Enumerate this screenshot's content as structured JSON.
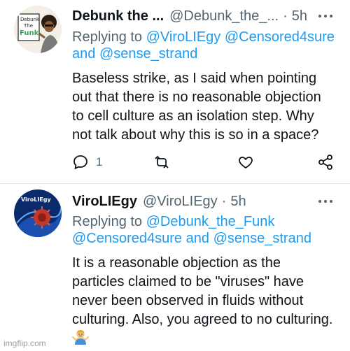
{
  "tweets": [
    {
      "display_name": "Debunk the ...",
      "handle": "@Debunk_the_...",
      "time": "5h",
      "reply_prefix": "Replying to",
      "reply_mention_1": "@ViroLIEgy",
      "reply_mention_2": "@Censored4sure",
      "reply_and": "and",
      "reply_mention_3": "@sense_strand",
      "body_lines": [
        "Baseless strike, as I said when pointing",
        "out that there is no reasonable objection",
        "to cell culture as an isolation step. Why",
        "not talk about why this is so in a space?"
      ],
      "reply_count": "1",
      "avatar_text": {
        "line1": "Debunk",
        "line2": "The",
        "line3": "Funk"
      }
    },
    {
      "display_name": "ViroLIEgy",
      "handle": "@ViroLIEgy",
      "time": "5h",
      "reply_prefix": "Replying to",
      "reply_mention_1": "@Debunk_the_Funk",
      "reply_mention_2": "@Censored4sure",
      "reply_and": "and",
      "reply_mention_3": "@sense_strand",
      "body_lines": [
        "It is a reasonable objection as the",
        "particles claimed to be \"viruses\" have",
        "never been observed in fluids without",
        "culturing. Also, you agreed to no culturing."
      ],
      "avatar_text": "ViroLIEgy"
    }
  ],
  "watermark": "imgflip.com",
  "colors": {
    "link": "#1d9bf0",
    "muted": "#536471",
    "text": "#0f1419"
  },
  "icons": [
    "more-icon",
    "reply-icon",
    "retweet-icon",
    "like-icon",
    "share-icon",
    "person-shrugging-emoji"
  ]
}
